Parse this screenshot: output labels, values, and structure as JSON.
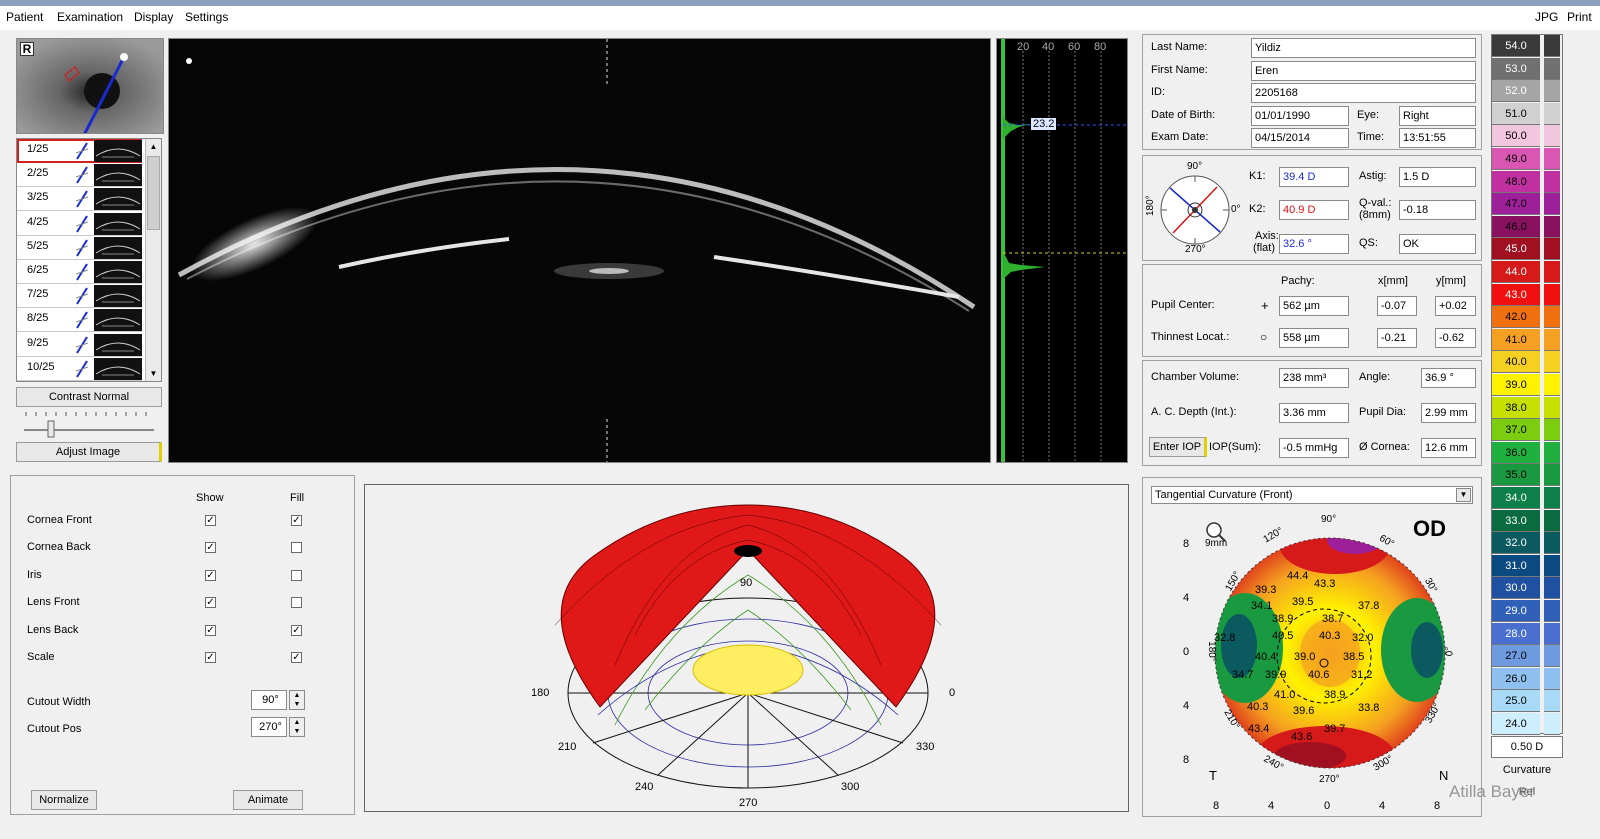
{
  "menu": {
    "patient": "Patient",
    "examination": "Examination",
    "display": "Display",
    "settings": "Settings",
    "jpg": "JPG",
    "print": "Print"
  },
  "eye_tag": "R",
  "scans": [
    {
      "label": "1/25"
    },
    {
      "label": "2/25"
    },
    {
      "label": "3/25"
    },
    {
      "label": "4/25"
    },
    {
      "label": "5/25"
    },
    {
      "label": "6/25"
    },
    {
      "label": "7/25"
    },
    {
      "label": "8/25"
    },
    {
      "label": "9/25"
    },
    {
      "label": "10/25"
    }
  ],
  "contrast_label": "Contrast Normal",
  "adjust_label": "Adjust Image",
  "profile": {
    "ticks": [
      "20",
      "40",
      "60",
      "80"
    ],
    "marker": "23.2"
  },
  "patient": {
    "last_name_label": "Last Name:",
    "last_name": "Yildiz",
    "first_name_label": "First Name:",
    "first_name": "Eren",
    "id_label": "ID:",
    "id": "2205168",
    "dob_label": "Date of Birth:",
    "dob": "01/01/1990",
    "eye_label": "Eye:",
    "eye": "Right",
    "exam_date_label": "Exam Date:",
    "exam_date": "04/15/2014",
    "time_label": "Time:",
    "time": "13:51:55"
  },
  "kerato": {
    "k1_label": "K1:",
    "k1": "39.4 D",
    "k2_label": "K2:",
    "k2": "40.9 D",
    "axis_label": "Axis:",
    "axis_sub": "(flat)",
    "axis": "32.6 °",
    "astig_label": "Astig:",
    "astig": "1.5 D",
    "qval_label": "Q-val.:",
    "qval_sub": "(8mm)",
    "qval": "-0.18",
    "qs_label": "QS:",
    "qs": "OK",
    "dial_90": "90°",
    "dial_0": "0°",
    "dial_180": "180°",
    "dial_270": "270°"
  },
  "pachy": {
    "pachy_label": "Pachy:",
    "x_label": "x[mm]",
    "y_label": "y[mm]",
    "pupil_label": "Pupil Center:",
    "pupil_symbol": "+",
    "pupil_pachy": "562 µm",
    "pupil_x": "-0.07",
    "pupil_y": "+0.02",
    "thin_label": "Thinnest Locat.:",
    "thin_symbol": "○",
    "thin_pachy": "558 µm",
    "thin_x": "-0.21",
    "thin_y": "-0.62"
  },
  "chamber": {
    "volume_label": "Chamber Volume:",
    "volume": "238 mm³",
    "angle_label": "Angle:",
    "angle": "36.9 °",
    "acd_label": "A. C. Depth (Int.):",
    "acd": "3.36 mm",
    "pupil_dia_label": "Pupil Dia:",
    "pupil_dia": "2.99 mm",
    "iop_button": "Enter IOP",
    "iop_label": "IOP(Sum):",
    "iop": "-0.5 mmHg",
    "cornea_label": "Ø Cornea:",
    "cornea": "12.6 mm"
  },
  "display_opts": {
    "show_header": "Show",
    "fill_header": "Fill",
    "rows": [
      {
        "label": "Cornea Front",
        "show": true,
        "fill": true
      },
      {
        "label": "Cornea Back",
        "show": true,
        "fill": false
      },
      {
        "label": "Iris",
        "show": true,
        "fill": false
      },
      {
        "label": "Lens Front",
        "show": true,
        "fill": false
      },
      {
        "label": "Lens Back",
        "show": true,
        "fill": true
      },
      {
        "label": "Scale",
        "show": true,
        "fill": true
      }
    ],
    "check_mark": "✓",
    "cutout_width_label": "Cutout Width",
    "cutout_width": "90°",
    "cutout_pos_label": "Cutout Pos",
    "cutout_pos": "270°",
    "normalize": "Normalize",
    "animate": "Animate"
  },
  "model3d": {
    "a0": "0",
    "a90": "90",
    "a180": "180",
    "a210": "210",
    "a240": "240",
    "a270": "270",
    "a300": "300",
    "a330": "330"
  },
  "map": {
    "select": "Tangential Curvature (Front)",
    "eye": "OD",
    "zoom_label": "9mm",
    "yticks": [
      "8",
      "4",
      "0",
      "4",
      "8"
    ],
    "xticks": [
      "8",
      "4",
      "0",
      "4",
      "8"
    ],
    "temporal": "T",
    "nasal": "N",
    "angles": {
      "a90": "90°",
      "a120": "120°",
      "a150": "150°",
      "a180": "180°",
      "a210": "210°",
      "a240": "240°",
      "a270": "270°",
      "a300": "300°",
      "a330": "330°",
      "a0": "0°",
      "a30": "30°",
      "a60": "60°"
    },
    "values": [
      "44.4",
      "43.3",
      "39.3",
      "39.5",
      "37.8",
      "34.1",
      "38.9",
      "38.7",
      "40.5",
      "40.3",
      "32.8",
      "32.0",
      "40.4",
      "39.0",
      "38.5",
      "31.2",
      "34.7",
      "39.9",
      "40.6",
      "41.0",
      "38.9",
      "33.8",
      "40.3",
      "39.6",
      "39.7",
      "43.4",
      "43.6"
    ]
  },
  "scale": {
    "values": [
      "54.0",
      "53.0",
      "52.0",
      "51.0",
      "50.0",
      "49.0",
      "48.0",
      "47.0",
      "46.0",
      "45.0",
      "44.0",
      "43.0",
      "42.0",
      "41.0",
      "40.0",
      "39.0",
      "38.0",
      "37.0",
      "36.0",
      "35.0",
      "34.0",
      "33.0",
      "32.0",
      "31.0",
      "30.0",
      "29.0",
      "28.0",
      "27.0",
      "26.0",
      "25.0",
      "24.0"
    ],
    "colors": [
      "#3a3a3a",
      "#707070",
      "#a5a5a5",
      "#d0d0d0",
      "#f2c6de",
      "#d957b2",
      "#c030a0",
      "#9e1f9a",
      "#8a1060",
      "#a01020",
      "#d61a1a",
      "#f01010",
      "#f07010",
      "#f5a020",
      "#f6d020",
      "#fff200",
      "#c8e000",
      "#7ccc10",
      "#20b040",
      "#1a9a40",
      "#0c8048",
      "#0a6a40",
      "#0a5a60",
      "#0a4a80",
      "#2050a0",
      "#3060b8",
      "#4a6fd0",
      "#6e9ae0",
      "#8ec0f0",
      "#a8daf8",
      "#cdeefe"
    ],
    "step": "0.50 D",
    "mode": "Curvature",
    "rel": "Rel"
  },
  "watermark": "Atilla Bayer"
}
